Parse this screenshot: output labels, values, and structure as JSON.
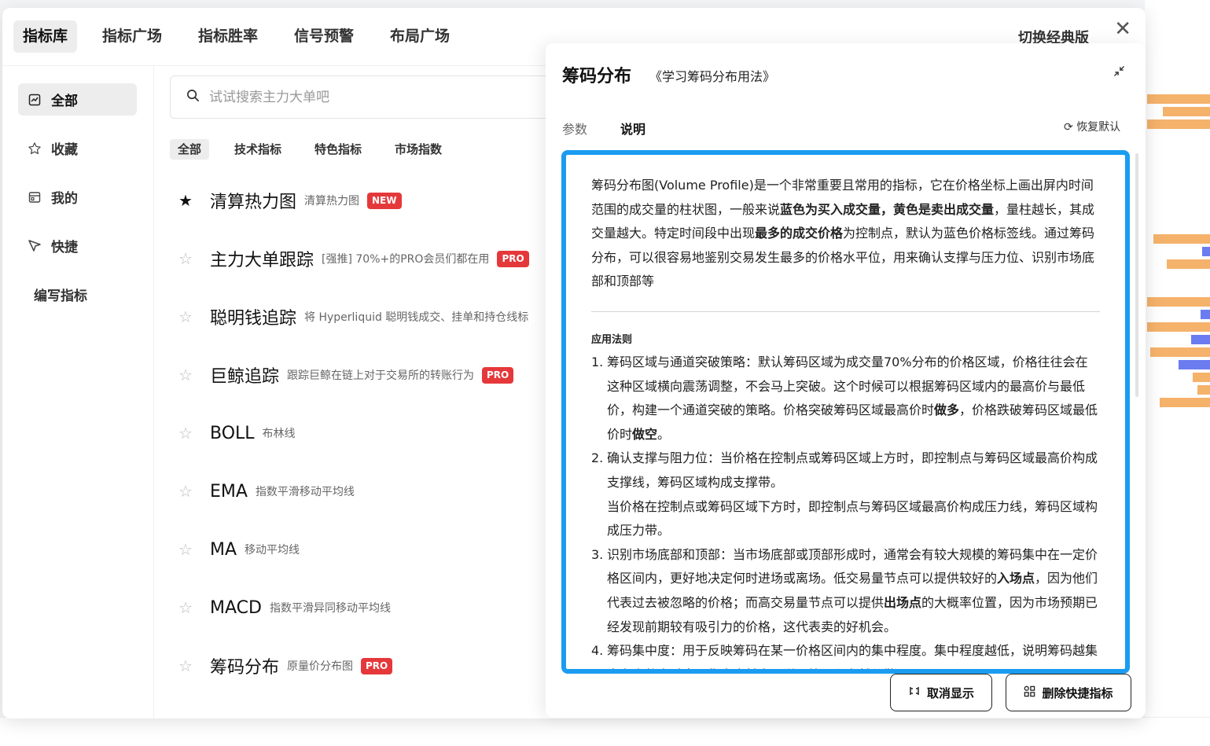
{
  "topnav": {
    "tabs": [
      "指标库",
      "指标广场",
      "指标胜率",
      "信号预警",
      "布局广场"
    ],
    "switch_label": "切换经典版",
    "close_label": "✕"
  },
  "sidebar": {
    "items": [
      {
        "label": "全部",
        "icon": "chart-icon"
      },
      {
        "label": "收藏",
        "icon": "star-icon"
      },
      {
        "label": "我的",
        "icon": "calendar-icon"
      },
      {
        "label": "快捷",
        "icon": "pointer-icon"
      },
      {
        "label": "编写指标",
        "icon": ""
      }
    ]
  },
  "search": {
    "placeholder": "试试搜索主力大单吧"
  },
  "filters": [
    "全部",
    "技术指标",
    "特色指标",
    "市场指数"
  ],
  "indicators": [
    {
      "name": "清算热力图",
      "desc": "清算热力图",
      "badge": "NEW",
      "starred": true
    },
    {
      "name": "主力大单跟踪",
      "desc": "[强推] 70%+的PRO会员们都在用",
      "badge": "PRO",
      "starred": false
    },
    {
      "name": "聪明钱追踪",
      "desc": "将 Hyperliquid 聪明钱成交、挂单和持仓线标",
      "badge": "",
      "starred": false
    },
    {
      "name": "巨鲸追踪",
      "desc": "跟踪巨鲸在链上对于交易所的转账行为",
      "badge": "PRO",
      "starred": false
    },
    {
      "name": "BOLL",
      "desc": "布林线",
      "badge": "",
      "starred": false
    },
    {
      "name": "EMA",
      "desc": "指数平滑移动平均线",
      "badge": "",
      "starred": false
    },
    {
      "name": "MA",
      "desc": "移动平均线",
      "badge": "",
      "starred": false
    },
    {
      "name": "MACD",
      "desc": "指数平滑异同移动平均线",
      "badge": "",
      "starred": false
    },
    {
      "name": "筹码分布",
      "desc": "原量价分布图",
      "badge": "PRO",
      "starred": false
    }
  ],
  "detail": {
    "title": "筹码分布",
    "link": "《学习筹码分布用法》",
    "tabs": [
      "参数",
      "说明"
    ],
    "reset_label": "恢复默认",
    "intro": [
      {
        "t": "筹码分布图(Volume Profile)是一个非常重要且常用的指标，它在价格坐标上画出屏内时间范围的成交量的柱状图，一般来说",
        "b": false
      },
      {
        "t": "蓝色为买入成交量，黄色是卖出成交量",
        "b": true
      },
      {
        "t": "，量柱越长，其成交量越大。特定时间段中出现",
        "b": false
      },
      {
        "t": "最多的成交价格",
        "b": true
      },
      {
        "t": "为控制点，默认为蓝色价格标签线。通过筹码分布，可以很容易地鉴别交易发生最多的价格水平位，用来确认支撑与压力位、识别市场底部和顶部等",
        "b": false
      }
    ],
    "rules_title": "应用法则",
    "rules": [
      {
        "num": "1.",
        "parts": [
          {
            "t": "筹码区域与通道突破策略：默认筹码区域为成交量70%分布的价格区域，价格往往会在这种区域横向震荡调整，不会马上突破。这个时候可以根据筹码区域内的最高价与最低价，构建一个通道突破的策略。价格突破筹码区域最高价时",
            "b": false
          },
          {
            "t": "做多",
            "b": true
          },
          {
            "t": "，价格跌破筹码区域最低价时",
            "b": false
          },
          {
            "t": "做空",
            "b": true
          },
          {
            "t": "。",
            "b": false
          }
        ]
      },
      {
        "num": "2.",
        "parts": [
          {
            "t": "确认支撑与阻力位：当价格在控制点或筹码区域上方时，即控制点与筹码区域最高价构成支撑线，筹码区域构成支撑带。",
            "b": false
          }
        ],
        "extra": "当价格在控制点或筹码区域下方时，即控制点与筹码区域最高价构成压力线，筹码区域构成压力带。"
      },
      {
        "num": "3.",
        "parts": [
          {
            "t": "识别市场底部和顶部：当市场底部或顶部形成时，通常会有较大规模的筹码集中在一定价格区间内，更好地决定何时进场或离场。低交易量节点可以提供较好的",
            "b": false
          },
          {
            "t": "入场点",
            "b": true
          },
          {
            "t": "，因为他们代表过去被忽略的价格；而高交易量节点可以提供",
            "b": false
          },
          {
            "t": "出场点",
            "b": true
          },
          {
            "t": "的大概率位置，因为市场预期已经发现前期较有吸引力的价格，这代表卖的好机会。",
            "b": false
          }
        ]
      },
      {
        "num": "4.",
        "parts": [
          {
            "t": "筹码集中度：用于反映筹码在某一价格区间内的集中程度。集中程度越低，说明筹码越集中在少数人手中，集中度越高，说明筹码分布越分散。",
            "b": false
          }
        ]
      }
    ],
    "cancel_label": "取消显示",
    "delete_label": "删除快捷指标"
  }
}
